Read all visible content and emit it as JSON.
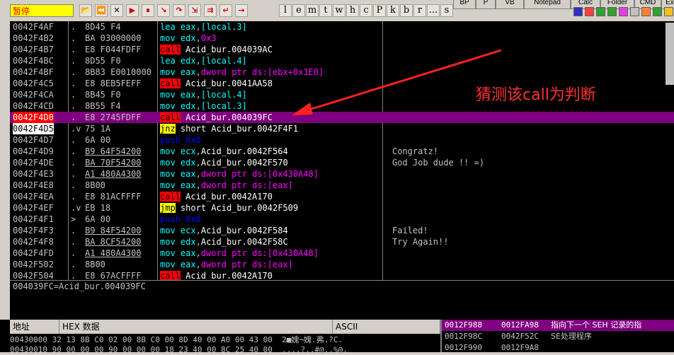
{
  "toolbar": {
    "status": "暂停",
    "buttons": [
      "open-icon",
      "rewind-icon",
      "close-icon",
      "run-icon",
      "pause-icon",
      "step-into-icon",
      "step-over-icon",
      "trace-into-icon",
      "trace-over-icon",
      "execute-till-return-icon",
      "goto-icon"
    ],
    "letters": [
      "l",
      "e",
      "m",
      "t",
      "w",
      "h",
      "c",
      "P",
      "k",
      "b",
      "r",
      "...",
      "s"
    ],
    "tabs": [
      "BP",
      "P",
      "VB",
      "Notepad",
      "Calc",
      "Folder",
      "CMD",
      "Ex"
    ]
  },
  "disasm": {
    "rows": [
      {
        "addr": "0042F4AF",
        "mark": ".",
        "hex": "8D45 F4",
        "asm": [
          [
            "m-lea",
            "lea"
          ],
          [
            "kw-op",
            " "
          ],
          [
            "kw-reg",
            "eax"
          ],
          [
            "kw-op",
            ","
          ],
          [
            "kw-reg",
            "[local.3]"
          ]
        ],
        "comment": ""
      },
      {
        "addr": "0042F4B2",
        "mark": ".",
        "hex": "BA 03000000",
        "asm": [
          [
            "m-mov",
            "mov"
          ],
          [
            "kw-op",
            " "
          ],
          [
            "kw-reg",
            "edx"
          ],
          [
            "kw-op",
            ","
          ],
          [
            "kw-num",
            "0x3"
          ]
        ],
        "comment": ""
      },
      {
        "addr": "0042F4B7",
        "mark": ".",
        "hex": "E8 F044FDFF",
        "asm": [
          [
            "m-call",
            "call"
          ],
          [
            "kw-op",
            " "
          ],
          [
            "kw-name",
            "Acid_bur.004039AC"
          ]
        ],
        "comment": ""
      },
      {
        "addr": "0042F4BC",
        "mark": ".",
        "hex": "8D55 F0",
        "asm": [
          [
            "m-lea",
            "lea"
          ],
          [
            "kw-op",
            " "
          ],
          [
            "kw-reg",
            "edx"
          ],
          [
            "kw-op",
            ","
          ],
          [
            "kw-reg",
            "[local.4]"
          ]
        ],
        "comment": ""
      },
      {
        "addr": "0042F4BF",
        "mark": ".",
        "hex": "8B83 E0010000",
        "asm": [
          [
            "m-mov",
            "mov"
          ],
          [
            "kw-op",
            " "
          ],
          [
            "kw-reg",
            "eax"
          ],
          [
            "kw-op",
            ","
          ],
          [
            "kw-ptr",
            "dword ptr ds:[ebx+0x1E0]"
          ]
        ],
        "comment": ""
      },
      {
        "addr": "0042F4C5",
        "mark": ".",
        "hex": "E8 8EB5FEFF",
        "asm": [
          [
            "m-call",
            "call"
          ],
          [
            "kw-op",
            " "
          ],
          [
            "kw-name",
            "Acid_bur.0041AA58"
          ]
        ],
        "comment": ""
      },
      {
        "addr": "0042F4CA",
        "mark": ".",
        "hex": "8B45 F0",
        "asm": [
          [
            "m-mov",
            "mov"
          ],
          [
            "kw-op",
            " "
          ],
          [
            "kw-reg",
            "eax"
          ],
          [
            "kw-op",
            ","
          ],
          [
            "kw-reg",
            "[local.4]"
          ]
        ],
        "comment": ""
      },
      {
        "addr": "0042F4CD",
        "mark": ".",
        "hex": "8B55 F4",
        "asm": [
          [
            "m-mov",
            "mov"
          ],
          [
            "kw-op",
            " "
          ],
          [
            "kw-reg",
            "edx"
          ],
          [
            "kw-op",
            ","
          ],
          [
            "kw-reg",
            "[local.3]"
          ]
        ],
        "comment": ""
      },
      {
        "addr": "0042F4D0",
        "mark": ".",
        "hex": "E8 2745FDFF",
        "asm": [
          [
            "m-call",
            "call"
          ],
          [
            "kw-op",
            " "
          ],
          [
            "kw-name",
            "Acid_bur.004039FC"
          ]
        ],
        "comment": "",
        "selected": true
      },
      {
        "addr": "0042F4D5",
        "mark": ".v",
        "hex": "75 1A",
        "asm": [
          [
            "m-jnz",
            "jnz"
          ],
          [
            "kw-op",
            " "
          ],
          [
            "kw-name",
            "short Acid_bur.0042F4F1"
          ]
        ],
        "comment": ""
      },
      {
        "addr": "0042F4D7",
        "mark": ".",
        "hex": "6A 00",
        "asm": [
          [
            "m-push",
            "push"
          ],
          [
            "kw-op",
            " "
          ],
          [
            "m-push",
            "0x0"
          ]
        ],
        "comment": ""
      },
      {
        "addr": "0042F4D9",
        "mark": ".",
        "hex": "B9 64F54200",
        "hexu": true,
        "asm": [
          [
            "m-mov",
            "mov"
          ],
          [
            "kw-op",
            " "
          ],
          [
            "kw-reg",
            "ecx"
          ],
          [
            "kw-op",
            ","
          ],
          [
            "kw-name",
            "Acid_bur.0042F564"
          ]
        ],
        "comment": "Congratz!"
      },
      {
        "addr": "0042F4DE",
        "mark": ".",
        "hex": "BA 70F54200",
        "hexu": true,
        "asm": [
          [
            "m-mov",
            "mov"
          ],
          [
            "kw-op",
            " "
          ],
          [
            "kw-reg",
            "edx"
          ],
          [
            "kw-op",
            ","
          ],
          [
            "kw-name",
            "Acid_bur.0042F570"
          ]
        ],
        "comment": "God Job dude !! =)"
      },
      {
        "addr": "0042F4E3",
        "mark": ".",
        "hex": "A1 480A4300",
        "hexu": true,
        "asm": [
          [
            "m-mov",
            "mov"
          ],
          [
            "kw-op",
            " "
          ],
          [
            "kw-reg",
            "eax"
          ],
          [
            "kw-op",
            ","
          ],
          [
            "kw-ptr",
            "dword ptr ds:[0x430A48]"
          ]
        ],
        "comment": ""
      },
      {
        "addr": "0042F4E8",
        "mark": ".",
        "hex": "8B00",
        "asm": [
          [
            "m-mov",
            "mov"
          ],
          [
            "kw-op",
            " "
          ],
          [
            "kw-reg",
            "eax"
          ],
          [
            "kw-op",
            ","
          ],
          [
            "kw-ptr",
            "dword ptr ds:[eax]"
          ]
        ],
        "comment": ""
      },
      {
        "addr": "0042F4EA",
        "mark": ".",
        "hex": "E8 81ACFFFF",
        "asm": [
          [
            "m-call",
            "call"
          ],
          [
            "kw-op",
            " "
          ],
          [
            "kw-name",
            "Acid_bur.0042A170"
          ]
        ],
        "comment": ""
      },
      {
        "addr": "0042F4EF",
        "mark": ".v",
        "hex": "EB 18",
        "asm": [
          [
            "m-jmp",
            "jmp"
          ],
          [
            "kw-op",
            " "
          ],
          [
            "kw-name",
            "short Acid_bur.0042F509"
          ]
        ],
        "comment": ""
      },
      {
        "addr": "0042F4F1",
        "mark": ">",
        "hex": "6A 00",
        "asm": [
          [
            "m-push",
            "push"
          ],
          [
            "kw-op",
            " "
          ],
          [
            "m-push",
            "0x0"
          ]
        ],
        "comment": ""
      },
      {
        "addr": "0042F4F3",
        "mark": ".",
        "hex": "B9 84F54200",
        "hexu": true,
        "asm": [
          [
            "m-mov",
            "mov"
          ],
          [
            "kw-op",
            " "
          ],
          [
            "kw-reg",
            "ecx"
          ],
          [
            "kw-op",
            ","
          ],
          [
            "kw-name",
            "Acid_bur.0042F584"
          ]
        ],
        "comment": "Failed!"
      },
      {
        "addr": "0042F4F8",
        "mark": ".",
        "hex": "BA 8CF54200",
        "hexu": true,
        "asm": [
          [
            "m-mov",
            "mov"
          ],
          [
            "kw-op",
            " "
          ],
          [
            "kw-reg",
            "edx"
          ],
          [
            "kw-op",
            ","
          ],
          [
            "kw-name",
            "Acid_bur.0042F58C"
          ]
        ],
        "comment": "Try Again!!"
      },
      {
        "addr": "0042F4FD",
        "mark": ".",
        "hex": "A1 480A4300",
        "hexu": true,
        "asm": [
          [
            "m-mov",
            "mov"
          ],
          [
            "kw-op",
            " "
          ],
          [
            "kw-reg",
            "eax"
          ],
          [
            "kw-op",
            ","
          ],
          [
            "kw-ptr",
            "dword ptr ds:[0x430A48]"
          ]
        ],
        "comment": ""
      },
      {
        "addr": "0042F502",
        "mark": ".",
        "hex": "8B00",
        "asm": [
          [
            "m-mov",
            "mov"
          ],
          [
            "kw-op",
            " "
          ],
          [
            "kw-reg",
            "eax"
          ],
          [
            "kw-op",
            ","
          ],
          [
            "kw-ptr",
            "dword ptr ds:[eax]"
          ]
        ],
        "comment": ""
      },
      {
        "addr": "0042F504",
        "mark": ".",
        "hex": "E8 67ACFFFF",
        "asm": [
          [
            "m-call",
            "call"
          ],
          [
            "kw-op",
            " "
          ],
          [
            "kw-name",
            "Acid_bur.0042A170"
          ]
        ],
        "comment": ""
      }
    ],
    "annotation": "猜测该call为判断"
  },
  "info": {
    "text": "004039FC=Acid_bur.004039FC"
  },
  "dump": {
    "headers": {
      "address": "地址",
      "hex": "HEX 数据",
      "ascii": "ASCII"
    },
    "rows": [
      "00430000 32 13 8B C0 02 00 8B C0 00 8D 40 00 A0 00 43 00  2■媿¬媿.弗.?C.",
      "00430010 90 00 00 00 90 00 00 00 18 23 40 00 8C 25 40 00  ....?..#@..%@."
    ]
  },
  "stack": {
    "rows": [
      {
        "addr": "0012F988",
        "value": "0012FA98",
        "comment": "指向下一个 SEH 记录的指",
        "sel": true
      },
      {
        "addr": "0012F98C",
        "value": "0042F52C",
        "comment": "SE处理程序"
      },
      {
        "addr": "0012F990",
        "value": "0012F9A8",
        "comment": ""
      }
    ]
  },
  "colors": {
    "selected_row": "#800080",
    "call_bg": "#ff0000",
    "jump_bg": "#ffff00",
    "annotation": "#ff3030"
  }
}
